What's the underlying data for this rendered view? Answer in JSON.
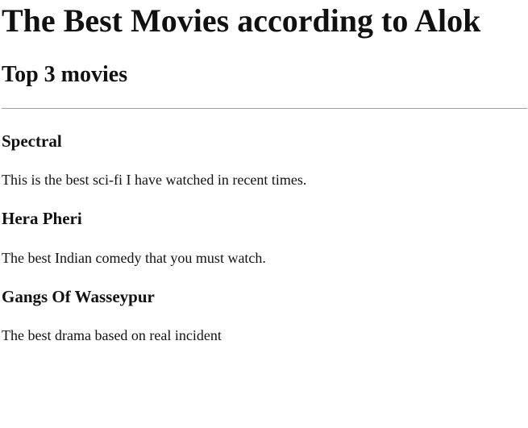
{
  "page": {
    "title": "The Best Movies according to Alok",
    "subtitle": "Top 3 movies"
  },
  "movies": [
    {
      "title": "Spectral",
      "description": "This is the best sci-fi I have watched in recent times."
    },
    {
      "title": "Hera Pheri",
      "description": "The best Indian comedy that you must watch."
    },
    {
      "title": "Gangs Of Wasseypur",
      "description": "The best drama based on real incident"
    }
  ]
}
